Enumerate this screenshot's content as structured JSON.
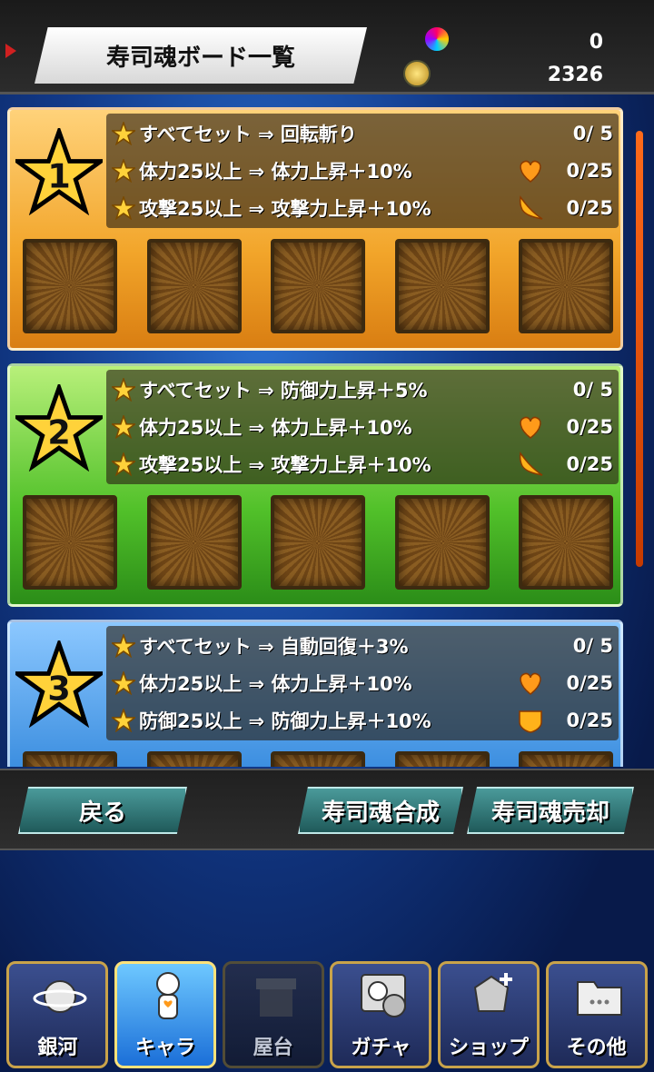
{
  "header": {
    "title": "寿司魂ボード一覧",
    "gems": "0",
    "coins": "2326"
  },
  "boards": [
    {
      "number": "1",
      "color": "#f2a52a",
      "rows": [
        {
          "text": "すべてセット ⇒ 回転斬り",
          "icon": "",
          "count": "0/  5"
        },
        {
          "text": "体力25以上 ⇒ 体力上昇＋10%",
          "icon": "heart-icon",
          "count": "0/25"
        },
        {
          "text": "攻撃25以上 ⇒ 攻撃力上昇＋10%",
          "icon": "claw-icon",
          "count": "0/25"
        }
      ]
    },
    {
      "number": "2",
      "color": "#52c12a",
      "rows": [
        {
          "text": "すべてセット ⇒ 防御力上昇＋5%",
          "icon": "",
          "count": "0/  5"
        },
        {
          "text": "体力25以上 ⇒ 体力上昇＋10%",
          "icon": "heart-icon",
          "count": "0/25"
        },
        {
          "text": "攻撃25以上 ⇒ 攻撃力上昇＋10%",
          "icon": "claw-icon",
          "count": "0/25"
        }
      ]
    },
    {
      "number": "3",
      "color": "#3d8fe0",
      "rows": [
        {
          "text": "すべてセット ⇒ 自動回復＋3%",
          "icon": "",
          "count": "0/  5"
        },
        {
          "text": "体力25以上 ⇒ 体力上昇＋10%",
          "icon": "heart-icon",
          "count": "0/25"
        },
        {
          "text": "防御25以上 ⇒ 防御力上昇＋10%",
          "icon": "shield-icon",
          "count": "0/25"
        }
      ]
    }
  ],
  "buttons": {
    "back": "戻る",
    "fuse": "寿司魂合成",
    "sell": "寿司魂売却"
  },
  "nav": [
    {
      "label": "銀河",
      "icon": "planet-icon",
      "state": "normal"
    },
    {
      "label": "キャラ",
      "icon": "character-icon",
      "state": "active"
    },
    {
      "label": "屋台",
      "icon": "stall-icon",
      "state": "dim"
    },
    {
      "label": "ガチャ",
      "icon": "gacha-icon",
      "state": "normal"
    },
    {
      "label": "ショップ",
      "icon": "shop-icon",
      "state": "normal"
    },
    {
      "label": "その他",
      "icon": "folder-icon",
      "state": "normal"
    }
  ]
}
